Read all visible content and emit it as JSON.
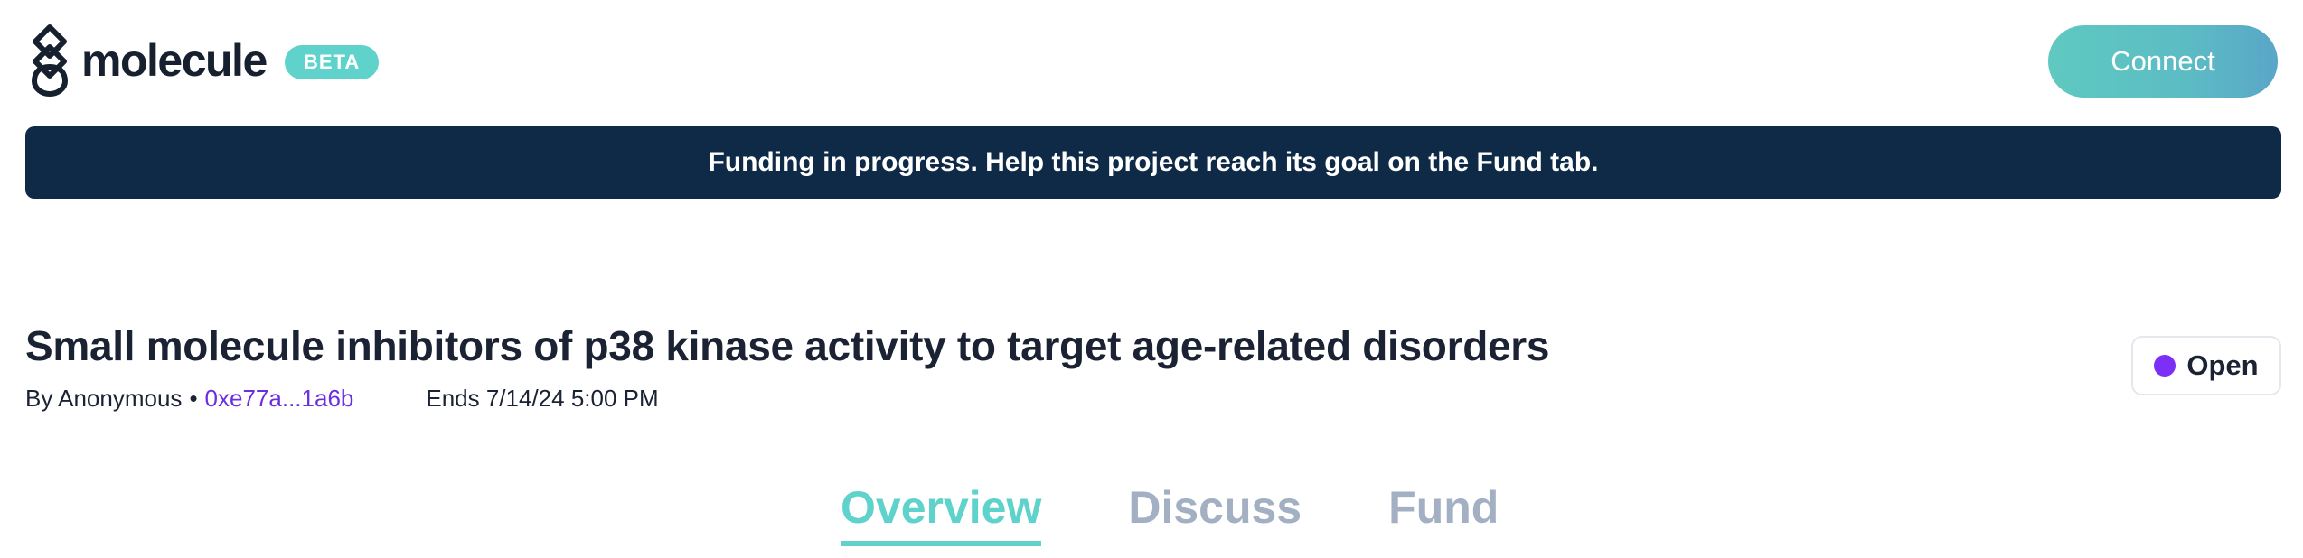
{
  "header": {
    "logo_text": "molecule",
    "beta_label": "BETA",
    "connect_label": "Connect"
  },
  "banner": {
    "text": "Funding in progress. Help this project reach its goal on the Fund tab."
  },
  "project": {
    "title": "Small molecule inhibitors of p38 kinase activity to target age-related disorders",
    "author": "By Anonymous",
    "separator": "•",
    "address": "0xe77a...1a6b",
    "ends": "Ends 7/14/24 5:00 PM",
    "status": "Open"
  },
  "tabs": [
    {
      "label": "Overview",
      "active": true
    },
    {
      "label": "Discuss",
      "active": false
    },
    {
      "label": "Fund",
      "active": false
    }
  ],
  "colors": {
    "accent": "#5fd3cb",
    "banner_bg": "#0f2a47",
    "address_link": "#6a2fe0",
    "status_dot": "#7b2ff7",
    "tab_inactive": "#a3afc2"
  },
  "icons": {
    "logo": "molecule-logo-icon",
    "status": "status-dot-icon"
  }
}
